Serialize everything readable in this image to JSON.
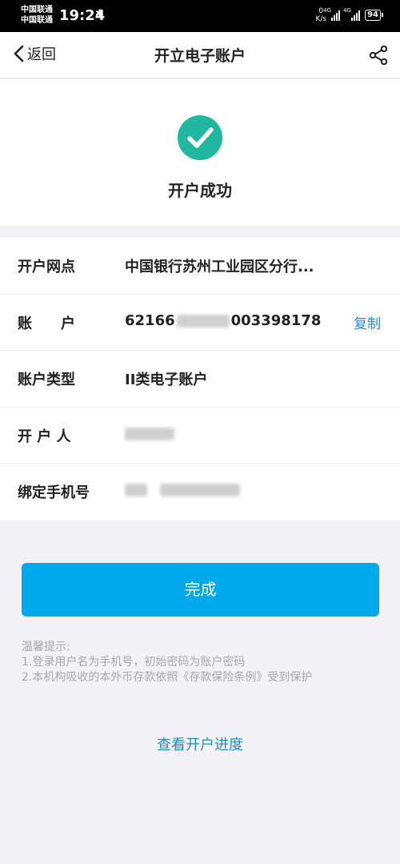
{
  "status_bar": {
    "carrier_1": "中国联通",
    "carrier_2": "中国联通",
    "time": "19:24",
    "net_speed_value": "0",
    "net_speed_unit": "K/s",
    "signal_1_tag": "4G",
    "signal_2_tag": "4G",
    "battery": "94"
  },
  "nav": {
    "back_label": "返回",
    "title": "开立电子账户"
  },
  "result": {
    "message": "开户成功",
    "accent_color": "#1fb79f"
  },
  "account_info": {
    "branch_label": "开户网点",
    "branch_value": "中国银行苏州工业园区分行...",
    "account_label": "账　　户",
    "account_prefix": "62166",
    "account_suffix": "003398178",
    "copy_label": "复制",
    "type_label": "账户类型",
    "type_value": "II类电子账户",
    "holder_label": "开 户 人",
    "phone_label": "绑定手机号"
  },
  "actions": {
    "done_label": "完成",
    "primary_color": "#00a8ec"
  },
  "tips": {
    "title": "温馨提示:",
    "line_1": "1.登录用户名为手机号，初始密码为账户密码",
    "line_2": "2.本机构吸收的本外币存款依照《存款保险条例》受到保护"
  },
  "links": {
    "progress_label": "查看开户进度"
  }
}
